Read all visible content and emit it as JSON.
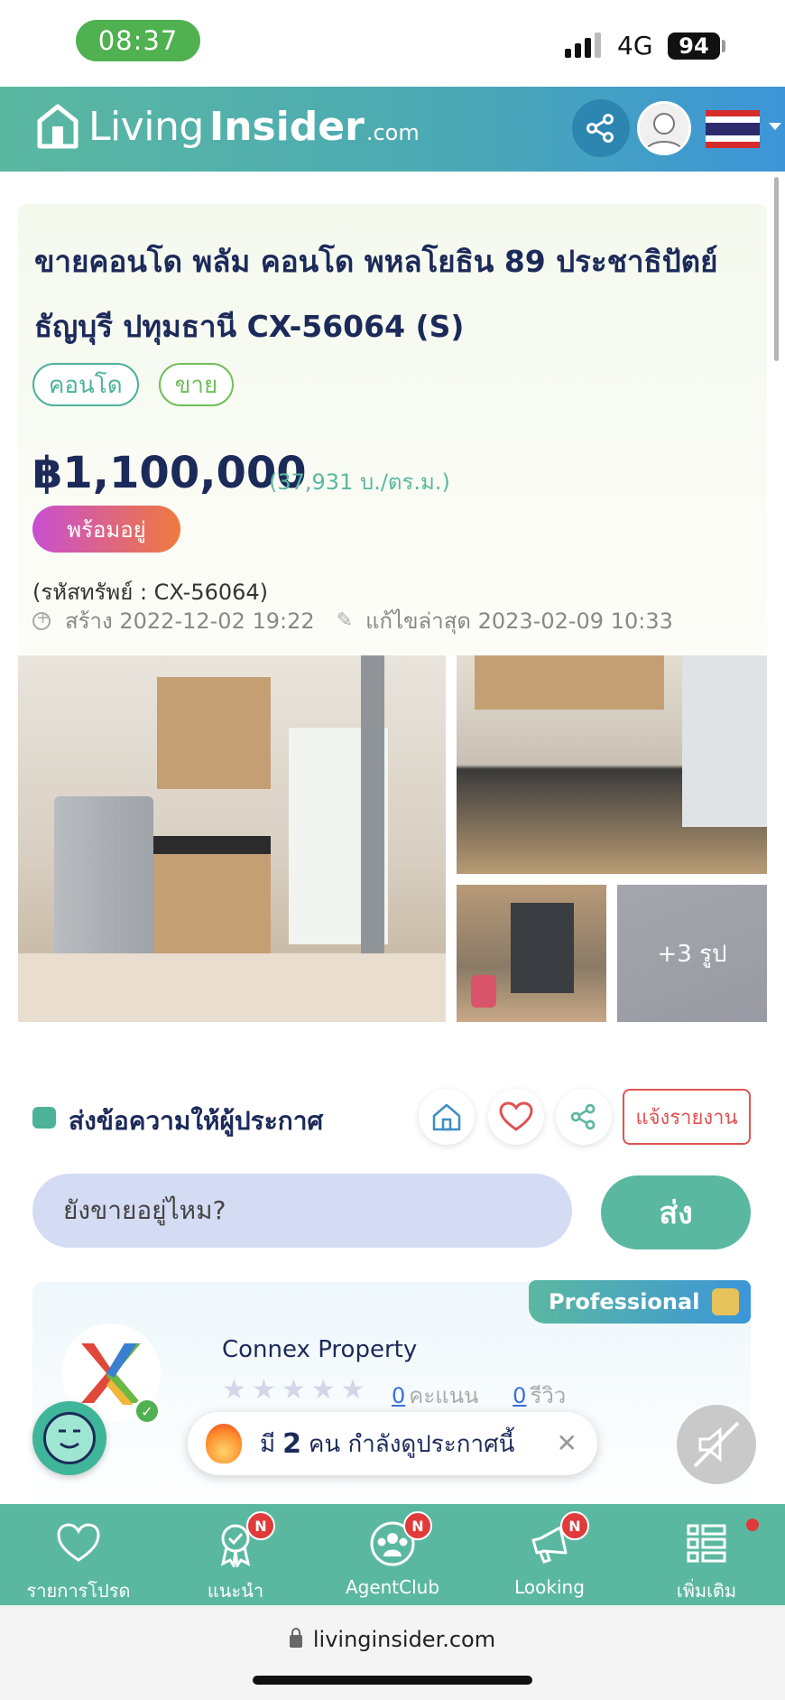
{
  "status_bar": {
    "time": "08:37",
    "network": "4G",
    "battery": "94"
  },
  "header": {
    "logo_part1": "Living",
    "logo_part2": "Insider",
    "logo_part3": ".com",
    "share_icon": "share-icon",
    "avatar_icon": "user-avatar-icon",
    "flag_icon": "thai-flag-icon"
  },
  "listing": {
    "title_line1": "ขายคอนโด พลัม คอนโด พหลโยธิน 89 ประชาธิปัตย์",
    "title_line2": "ธัญบุรี ปทุมธานี CX-56064 (S)",
    "tags": [
      "คอนโด",
      "ขาย"
    ],
    "price": "฿1,100,000",
    "price_per_sqm": "(37,931 บ./ตร.ม.)",
    "ready_badge": "พร้อมอยู่",
    "property_code": "(รหัสทรัพย์ : CX-56064)",
    "created": "สร้าง 2022-12-02 19:22",
    "edited": "แก้ไขล่าสุด 2023-02-09 10:33"
  },
  "photos": {
    "more_label": "+3 รูป"
  },
  "contact": {
    "label": "ส่งข้อความให้ผู้ประกาศ",
    "report_label": "แจ้งรายงาน",
    "message_value": "ยังขายอยู่ไหม?",
    "send_label": "ส่ง"
  },
  "agent": {
    "badge": "Professional",
    "name": "Connex Property",
    "rating_count": "0",
    "rating_label": "คะแนน",
    "review_count": "0",
    "review_label": "รีวิว"
  },
  "toast": {
    "prefix": "มี",
    "count": "2",
    "suffix": "คน กำลังดูประกาศนี้",
    "close": "✕"
  },
  "bottom_nav": [
    {
      "label": "รายการโปรด",
      "icon": "heart-icon",
      "badge": ""
    },
    {
      "label": "แนะนำ",
      "icon": "award-icon",
      "badge": "N"
    },
    {
      "label": "AgentClub",
      "icon": "group-icon",
      "badge": "N"
    },
    {
      "label": "Looking",
      "icon": "megaphone-icon",
      "badge": "N"
    },
    {
      "label": "เพิ่มเติม",
      "icon": "list-icon",
      "badge": ""
    }
  ],
  "browser": {
    "url": "livinginsider.com"
  },
  "colors": {
    "brand_green": "#5bb8a0",
    "brand_blue": "#3c95d8",
    "title_navy": "#1c2a5a",
    "report_red": "#e05252"
  }
}
